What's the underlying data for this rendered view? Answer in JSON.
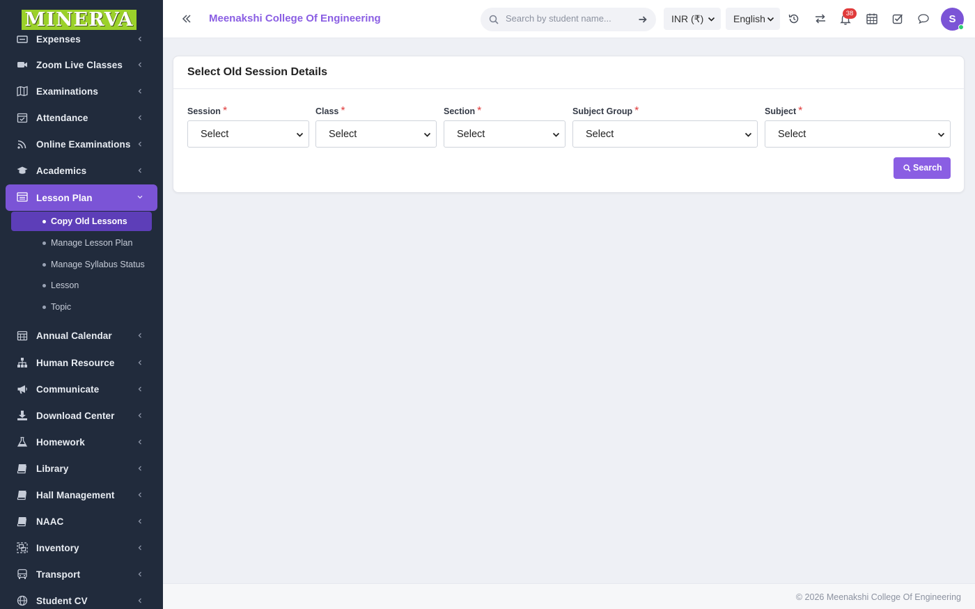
{
  "sidebar": {
    "logo_text": "MINERVA",
    "items": [
      {
        "label": "Expenses",
        "icon": "money-icon"
      },
      {
        "label": "Zoom Live Classes",
        "icon": "video-camera-icon"
      },
      {
        "label": "Examinations",
        "icon": "map-icon"
      },
      {
        "label": "Attendance",
        "icon": "calendar-check-icon"
      },
      {
        "label": "Online Examinations",
        "icon": "rss-icon"
      },
      {
        "label": "Academics",
        "icon": "graduation-cap-icon"
      },
      {
        "label": "Lesson Plan",
        "icon": "list-alt-icon",
        "active": true
      },
      {
        "label": "Annual Calendar",
        "icon": "calendar-icon"
      },
      {
        "label": "Human Resource",
        "icon": "sitemap-icon"
      },
      {
        "label": "Communicate",
        "icon": "bullhorn-icon"
      },
      {
        "label": "Download Center",
        "icon": "download-icon"
      },
      {
        "label": "Homework",
        "icon": "flask-icon"
      },
      {
        "label": "Library",
        "icon": "book-icon"
      },
      {
        "label": "Hall Management",
        "icon": "book-icon"
      },
      {
        "label": "NAAC",
        "icon": "book-icon"
      },
      {
        "label": "Inventory",
        "icon": "object-group-icon"
      },
      {
        "label": "Transport",
        "icon": "bus-icon"
      },
      {
        "label": "Student CV",
        "icon": "globe-icon"
      }
    ],
    "lesson_plan_sub": [
      {
        "label": "Copy Old Lessons",
        "active": true
      },
      {
        "label": "Manage Lesson Plan"
      },
      {
        "label": "Manage Syllabus Status"
      },
      {
        "label": "Lesson"
      },
      {
        "label": "Topic"
      }
    ]
  },
  "header": {
    "college_name": "Meenakshi College Of Engineering",
    "search_placeholder": "Search by student name...",
    "currency": "INR (₹)",
    "language": "English",
    "notification_count": "38",
    "avatar_initial": "S"
  },
  "card": {
    "title": "Select Old Session Details",
    "fields": [
      {
        "label": "Session",
        "value": "Select"
      },
      {
        "label": "Class",
        "value": "Select"
      },
      {
        "label": "Section",
        "value": "Select"
      },
      {
        "label": "Subject Group",
        "value": "Select"
      },
      {
        "label": "Subject",
        "value": "Select"
      }
    ],
    "required_mark": "*",
    "search_button": "Search"
  },
  "footer": {
    "text": "© 2026 Meenakshi College Of Engineering"
  },
  "colors": {
    "sidebar_bg": "#212b3c",
    "accent": "#7b54d6",
    "active_sub_bg": "#5d3eb8",
    "button": "#8a5ee3",
    "logo_bg": "#9bd12a",
    "badge": "#e03b3b"
  }
}
